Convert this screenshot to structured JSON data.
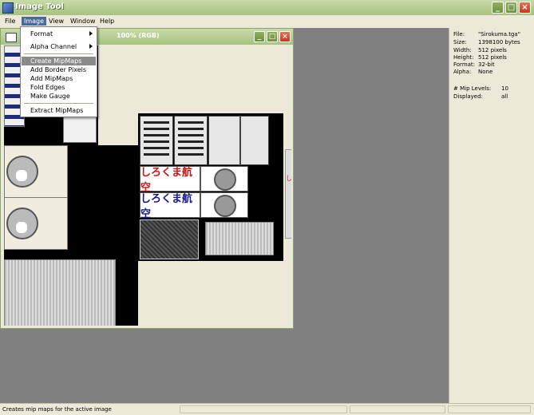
{
  "app": {
    "title": "Image Tool"
  },
  "menubar": [
    "File",
    "Image",
    "View",
    "Window",
    "Help"
  ],
  "image_menu": {
    "items": [
      {
        "label": "Format",
        "submenu": true
      },
      {
        "label": "Alpha Channel",
        "submenu": true
      },
      {
        "label": "Create MipMaps",
        "highlighted": true
      },
      {
        "label": "Add Border Pixels"
      },
      {
        "label": "Add MipMaps"
      },
      {
        "label": "Fold Edges"
      },
      {
        "label": "Make Gauge"
      },
      {
        "label": "Extract MipMaps"
      }
    ]
  },
  "child_window": {
    "title_visible": "100% (RGB)"
  },
  "canvas": {
    "logo1": "しろくま航空",
    "logo2": "しろくま航空",
    "logo1_color": "#c81414",
    "logo2_color": "#14148c",
    "side_text": "し"
  },
  "info": {
    "file_label": "File:",
    "file_value": "\"Sirokuma.tga\"",
    "size_label": "Size:",
    "size_value": "1398100 bytes",
    "width_label": "Width:",
    "width_value": "512 pixels",
    "height_label": "Height:",
    "height_value": "512 pixels",
    "format_label": "Format:",
    "format_value": "32-bit",
    "alpha_label": "Alpha:",
    "alpha_value": "None",
    "mip_label": "# Mip Levels:",
    "mip_value": "10",
    "disp_label": "Displayed:",
    "disp_value": "all"
  },
  "status": {
    "text": "Creates mip maps for the active image"
  }
}
